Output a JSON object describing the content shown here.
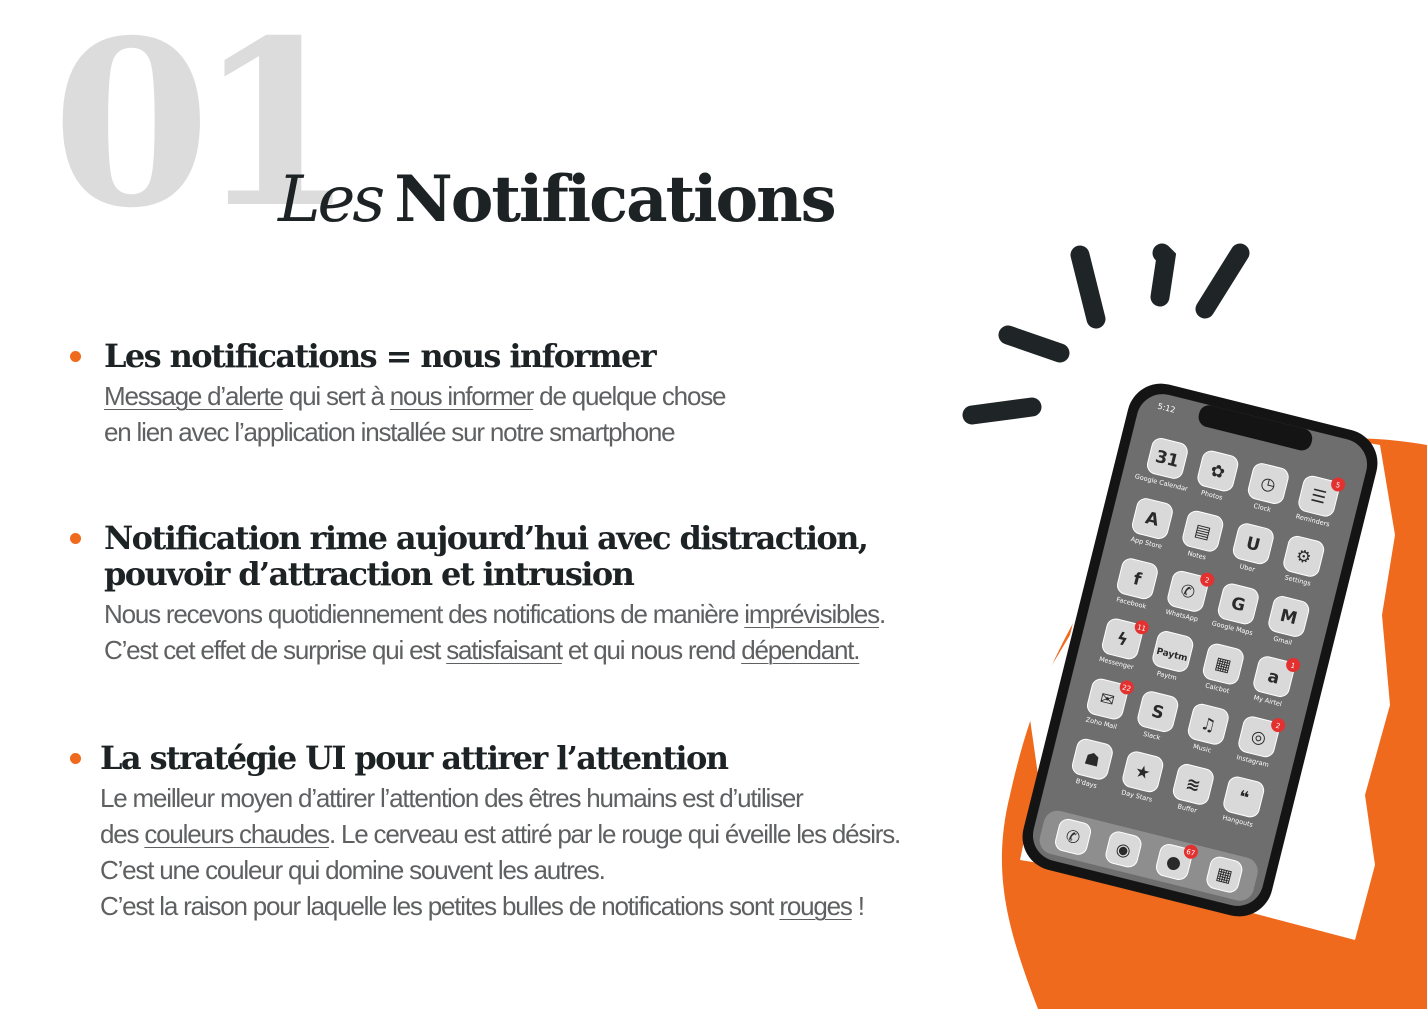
{
  "slide": {
    "number": "01",
    "title_prefix": "Les",
    "title_word": "Notifications"
  },
  "sections": [
    {
      "heading_1": "Les notifications = nous informer",
      "l1_a": "Message d’alerte",
      "l1_b": " qui sert à ",
      "l1_c": "nous informer",
      "l1_d": " de quelque chose",
      "l2": "en lien avec l’application installée sur notre smartphone"
    },
    {
      "heading_1": "Notification rime aujourd’hui avec distraction,",
      "heading_2": "pouvoir d’attraction et intrusion",
      "l1_a": "Nous recevons quotidiennement des notifications de manière ",
      "l1_b": "imprévisibles",
      "l2_a": "C’est cet effet de surprise qui est ",
      "l2_b": "satisfaisant",
      "l2_c": " et qui nous rend ",
      "l2_d": "dépendant."
    },
    {
      "heading_1": "La stratégie UI pour attirer l’attention",
      "l1": "Le meilleur moyen d’attirer l’attention des êtres humains est d’utiliser",
      "l2_a": "des ",
      "l2_b": "couleurs chaudes",
      "l2_c": ". Le cerveau est attiré par le rouge qui éveille les désirs.",
      "l3": "C’est une couleur qui domine souvent les autres.",
      "l4_a": "C’est la raison pour laquelle les petites bulles de notifications sont ",
      "l4_b": "rouges",
      "l4_c": " !"
    }
  ],
  "phone": {
    "time": "5:12",
    "apps": [
      {
        "label": "Google Calendar",
        "icon": "calendar-icon",
        "glyph": "31",
        "badge": ""
      },
      {
        "label": "Photos",
        "icon": "photos-icon",
        "glyph": "✿",
        "badge": ""
      },
      {
        "label": "Clock",
        "icon": "clock-icon",
        "glyph": "◷",
        "badge": ""
      },
      {
        "label": "Reminders",
        "icon": "reminders-icon",
        "glyph": "☰",
        "badge": "5"
      },
      {
        "label": "App Store",
        "icon": "app-store-icon",
        "glyph": "A",
        "badge": ""
      },
      {
        "label": "Notes",
        "icon": "notes-icon",
        "glyph": "▤",
        "badge": ""
      },
      {
        "label": "Uber",
        "icon": "uber-icon",
        "glyph": "U",
        "badge": ""
      },
      {
        "label": "Settings",
        "icon": "settings-icon",
        "glyph": "⚙",
        "badge": ""
      },
      {
        "label": "Facebook",
        "icon": "facebook-icon",
        "glyph": "f",
        "badge": ""
      },
      {
        "label": "WhatsApp",
        "icon": "whatsapp-icon",
        "glyph": "✆",
        "badge": "2"
      },
      {
        "label": "Google Maps",
        "icon": "maps-icon",
        "glyph": "G",
        "badge": ""
      },
      {
        "label": "Gmail",
        "icon": "gmail-icon",
        "glyph": "M",
        "badge": ""
      },
      {
        "label": "Messenger",
        "icon": "messenger-icon",
        "glyph": "ϟ",
        "badge": "11"
      },
      {
        "label": "Paytm",
        "icon": "paytm-icon",
        "glyph": "Paytm",
        "badge": ""
      },
      {
        "label": "Calcbot",
        "icon": "calcbot-icon",
        "glyph": "▦",
        "badge": ""
      },
      {
        "label": "My Airtel",
        "icon": "airtel-icon",
        "glyph": "a",
        "badge": "1"
      },
      {
        "label": "Zoho Mail",
        "icon": "zoho-mail-icon",
        "glyph": "✉",
        "badge": "22"
      },
      {
        "label": "Slack",
        "icon": "slack-icon",
        "glyph": "S",
        "badge": ""
      },
      {
        "label": "Music",
        "icon": "music-icon",
        "glyph": "♫",
        "badge": ""
      },
      {
        "label": "Instagram",
        "icon": "instagram-icon",
        "glyph": "◎",
        "badge": "2"
      },
      {
        "label": "B'days",
        "icon": "bdays-icon",
        "glyph": "☗",
        "badge": ""
      },
      {
        "label": "Day Stars",
        "icon": "day-stars-icon",
        "glyph": "★",
        "badge": ""
      },
      {
        "label": "Buffer",
        "icon": "buffer-icon",
        "glyph": "≋",
        "badge": ""
      },
      {
        "label": "Hangouts",
        "icon": "hangouts-icon",
        "glyph": "❝",
        "badge": ""
      }
    ],
    "dock": [
      {
        "label": "",
        "icon": "phone-icon",
        "glyph": "✆",
        "badge": ""
      },
      {
        "label": "",
        "icon": "camera-icon",
        "glyph": "◉",
        "badge": ""
      },
      {
        "label": "",
        "icon": "messages-icon",
        "glyph": "●",
        "badge": "67"
      },
      {
        "label": "",
        "icon": "folder-icon",
        "glyph": "▦",
        "badge": ""
      }
    ]
  },
  "colors": {
    "accent": "#ef6a1d",
    "heading": "#1d2224",
    "body": "#5f6062",
    "number": "#dcdcdc",
    "badge": "#e3312f"
  }
}
